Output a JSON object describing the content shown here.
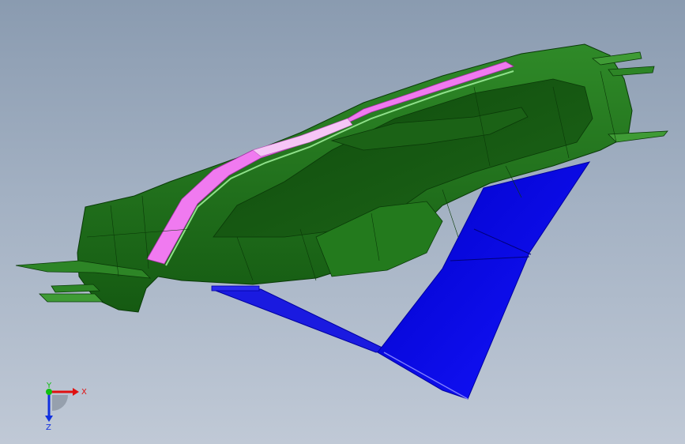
{
  "viewport": {
    "background_top": "#8a9bb0",
    "background_bottom": "#c0c9d6"
  },
  "model": {
    "body_color": "#1f6e1a",
    "body_dark": "#0f4a0c",
    "body_light": "#3f9b35",
    "highlight_color": "#f07af0",
    "highlight_light": "#f6c6f6",
    "support_color": "#1010e6",
    "support_dark": "#0000a8"
  },
  "triad": {
    "x_label": "X",
    "y_label": "Y",
    "z_label": "Z",
    "x_color": "#e01010",
    "y_color": "#10c010",
    "z_color": "#1030e0"
  }
}
